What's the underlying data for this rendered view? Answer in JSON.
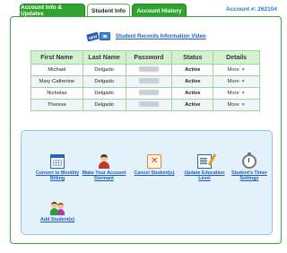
{
  "tabs": [
    {
      "label": "Account Info & Updates"
    },
    {
      "label": "Student Info"
    },
    {
      "label": "Account History"
    }
  ],
  "account_label": "Account #: 262104",
  "video": {
    "badge": "NEW",
    "link": "Student Records Information Video"
  },
  "table": {
    "headers": [
      "First Name",
      "Last Name",
      "Password",
      "Status",
      "Details"
    ],
    "rows": [
      {
        "first": "Michael",
        "last": "Delgado",
        "status": "Active",
        "details": "More"
      },
      {
        "first": "Mary Catherine",
        "last": "Delgado",
        "status": "Active",
        "details": "More"
      },
      {
        "first": "Nicholas",
        "last": "Delgado",
        "status": "Active",
        "details": "More"
      },
      {
        "first": "Therese",
        "last": "Delgado",
        "status": "Active",
        "details": "More"
      }
    ]
  },
  "actions": [
    {
      "label": "Convert to Monthly Billing",
      "icon": "calendar-icon"
    },
    {
      "label": "Make Your Account Dormant",
      "icon": "user-icon"
    },
    {
      "label": "Cancel Student(s)",
      "icon": "cancel-icon"
    },
    {
      "label": "Update Education Level",
      "icon": "edit-document-icon"
    },
    {
      "label": "Student's Timer Settings",
      "icon": "stopwatch-icon"
    },
    {
      "label": "Add Student(s)",
      "icon": "add-users-icon"
    }
  ],
  "colors": {
    "tab_green": "#2fa52f",
    "link_blue": "#1f5fbf",
    "active_green": "#2ea52e",
    "header_green": "#d4f2d2",
    "action_bg": "#e3f1fb"
  }
}
